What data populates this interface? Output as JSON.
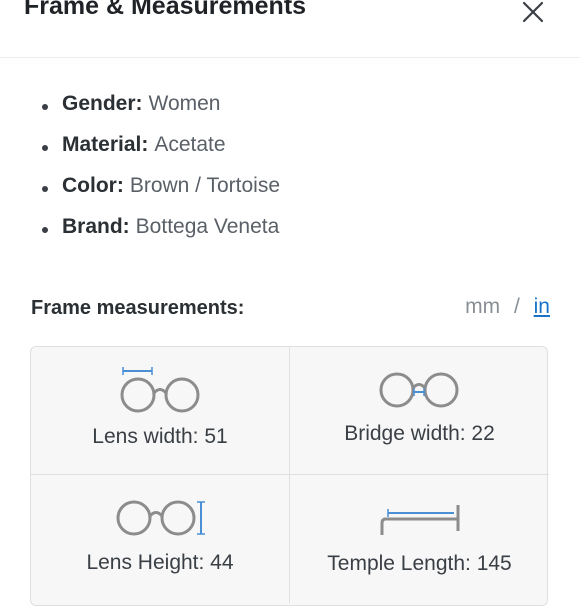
{
  "dialog": {
    "title": "Frame & Measurements"
  },
  "specs": [
    {
      "label": "Gender:",
      "value": "Women"
    },
    {
      "label": "Material:",
      "value": "Acetate"
    },
    {
      "label": "Color:",
      "value": "Brown / Tortoise"
    },
    {
      "label": "Brand:",
      "value": "Bottega Veneta"
    }
  ],
  "measurements": {
    "heading": "Frame measurements:",
    "unit_mm": "mm",
    "unit_sep": "/",
    "unit_in": "in",
    "accent_color": "#1a73c9",
    "items": [
      {
        "label": "Lens width: 51",
        "icon": "lens-width-icon"
      },
      {
        "label": "Bridge width: 22",
        "icon": "bridge-width-icon"
      },
      {
        "label": "Lens Height: 44",
        "icon": "lens-height-icon"
      },
      {
        "label": "Temple Length: 145",
        "icon": "temple-length-icon"
      }
    ]
  }
}
